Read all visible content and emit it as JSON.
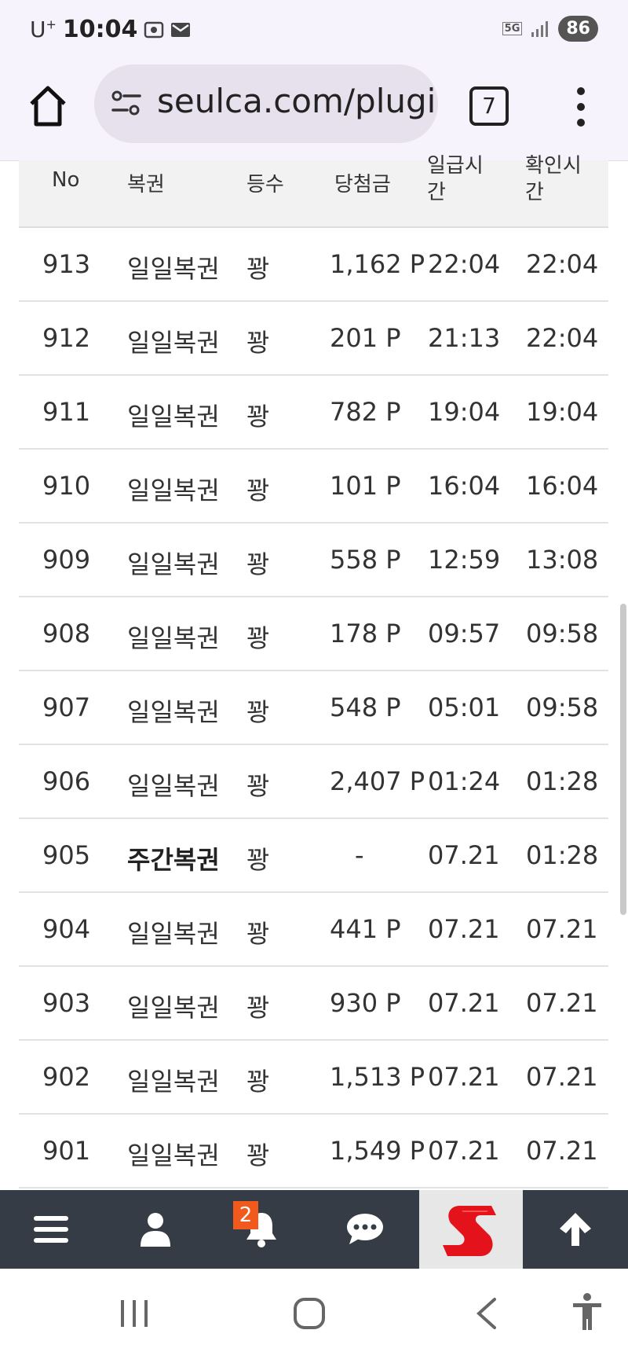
{
  "status_bar": {
    "carrier": "U",
    "carrier_sup": "+",
    "time": "10:04",
    "network": "5G",
    "battery": "86"
  },
  "browser": {
    "url": "seulca.com/plugin",
    "tab_count": "7"
  },
  "table": {
    "headers": {
      "no": "No",
      "lotto": "복권",
      "rank": "등수",
      "prize": "당첨금",
      "win_time": "일급시간",
      "confirm_time": "확인시간"
    },
    "rows": [
      {
        "no": "913",
        "lotto": "일일복권",
        "rank": "꽝",
        "prize": "1,162 P",
        "win": "22:04",
        "confirm": "22:04"
      },
      {
        "no": "912",
        "lotto": "일일복권",
        "rank": "꽝",
        "prize": "201 P",
        "win": "21:13",
        "confirm": "22:04"
      },
      {
        "no": "911",
        "lotto": "일일복권",
        "rank": "꽝",
        "prize": "782 P",
        "win": "19:04",
        "confirm": "19:04"
      },
      {
        "no": "910",
        "lotto": "일일복권",
        "rank": "꽝",
        "prize": "101 P",
        "win": "16:04",
        "confirm": "16:04"
      },
      {
        "no": "909",
        "lotto": "일일복권",
        "rank": "꽝",
        "prize": "558 P",
        "win": "12:59",
        "confirm": "13:08"
      },
      {
        "no": "908",
        "lotto": "일일복권",
        "rank": "꽝",
        "prize": "178 P",
        "win": "09:57",
        "confirm": "09:58"
      },
      {
        "no": "907",
        "lotto": "일일복권",
        "rank": "꽝",
        "prize": "548 P",
        "win": "05:01",
        "confirm": "09:58"
      },
      {
        "no": "906",
        "lotto": "일일복권",
        "rank": "꽝",
        "prize": "2,407 P",
        "win": "01:24",
        "confirm": "01:28"
      },
      {
        "no": "905",
        "lotto": "주간복권",
        "rank": "꽝",
        "prize": "-",
        "win": "07.21",
        "confirm": "01:28"
      },
      {
        "no": "904",
        "lotto": "일일복권",
        "rank": "꽝",
        "prize": "441 P",
        "win": "07.21",
        "confirm": "07.21"
      },
      {
        "no": "903",
        "lotto": "일일복권",
        "rank": "꽝",
        "prize": "930 P",
        "win": "07.21",
        "confirm": "07.21"
      },
      {
        "no": "902",
        "lotto": "일일복권",
        "rank": "꽝",
        "prize": "1,513 P",
        "win": "07.21",
        "confirm": "07.21"
      },
      {
        "no": "901",
        "lotto": "일일복권",
        "rank": "꽝",
        "prize": "1,549 P",
        "win": "07.21",
        "confirm": "07.21"
      }
    ]
  },
  "site_nav": {
    "notification_count": "2",
    "icons": [
      "menu-icon",
      "user-icon",
      "bell-icon",
      "chat-icon",
      "site-logo",
      "arrow-up-icon"
    ]
  },
  "colors": {
    "nav_bg": "#353c45",
    "badge": "#f25a1d",
    "logo_red": "#e3121b",
    "browser_bg": "#f7f3fc"
  }
}
